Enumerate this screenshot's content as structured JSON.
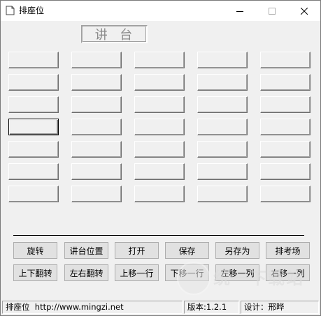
{
  "window": {
    "title": "排座位",
    "icons": {
      "app": "document-icon",
      "minimize": "minimize-icon",
      "maximize": "maximize-icon",
      "close": "close-icon"
    }
  },
  "podium": {
    "label": "讲  台"
  },
  "seats": {
    "columns": 5,
    "rows": 7,
    "selected": {
      "row": 4,
      "column": 1
    }
  },
  "buttons": {
    "rotate": "旋转",
    "podium_position": "讲台位置",
    "open": "打开",
    "save": "保存",
    "save_as": "另存为",
    "arrange_exam": "排考场",
    "flip_vertical": "上下翻转",
    "flip_horizontal": "左右翻转",
    "move_up_row": "上移一行",
    "move_down_row": "下移一行",
    "move_left_col": "左移一列",
    "move_right_col": "右移一列"
  },
  "statusbar": {
    "app_info": "排座位  http://www.mingzi.net",
    "version": "版本:1.2.1",
    "designer": "设计：邢晔"
  },
  "watermark": {
    "text": "统一下载站"
  }
}
